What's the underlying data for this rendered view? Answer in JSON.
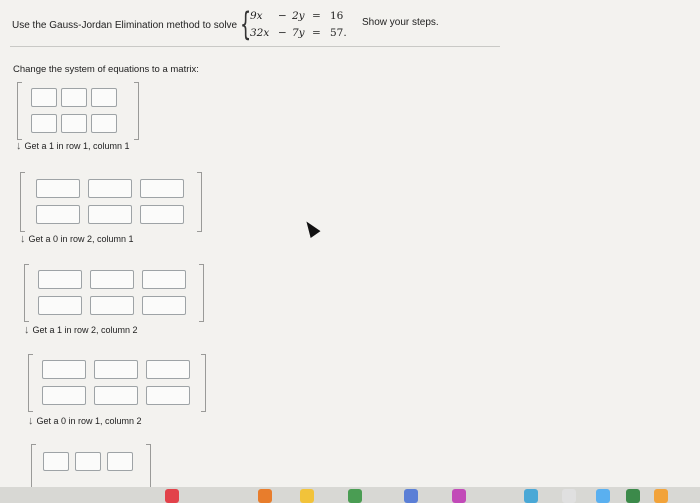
{
  "header": {
    "prompt": "Use the Gauss-Jordan Elimination method to solve",
    "tail": "Show your steps.",
    "equations": [
      {
        "coef_x": "9x",
        "op": "−",
        "coef_y": "2y",
        "eq": "=",
        "rhs": "16"
      },
      {
        "coef_x": "32x",
        "op": "−",
        "coef_y": "7y",
        "eq": "=",
        "rhs": "57."
      }
    ]
  },
  "change_label": "Change the system of equations to a matrix:",
  "steps": [
    {
      "label": "Get a 1 in row 1, column 1"
    },
    {
      "label": "Get a 0 in row 2, column 1"
    },
    {
      "label": "Get a 1 in row 2, column 2"
    },
    {
      "label": "Get a 0 in row 1, column 2"
    }
  ],
  "icons": {
    "step_arrow": "arrow-down-icon",
    "cursor": "mouse-cursor-icon"
  },
  "dock": {
    "icon_colors": [
      "#e2424a",
      "#e87d2c",
      "#f2c33a",
      "#4a9d53",
      "#5b7fd6",
      "#c24ab8",
      "#4aa8d6",
      "#e0e0e0",
      "#5ab0f0",
      "#3c8a4a",
      "#f2a33a"
    ]
  }
}
